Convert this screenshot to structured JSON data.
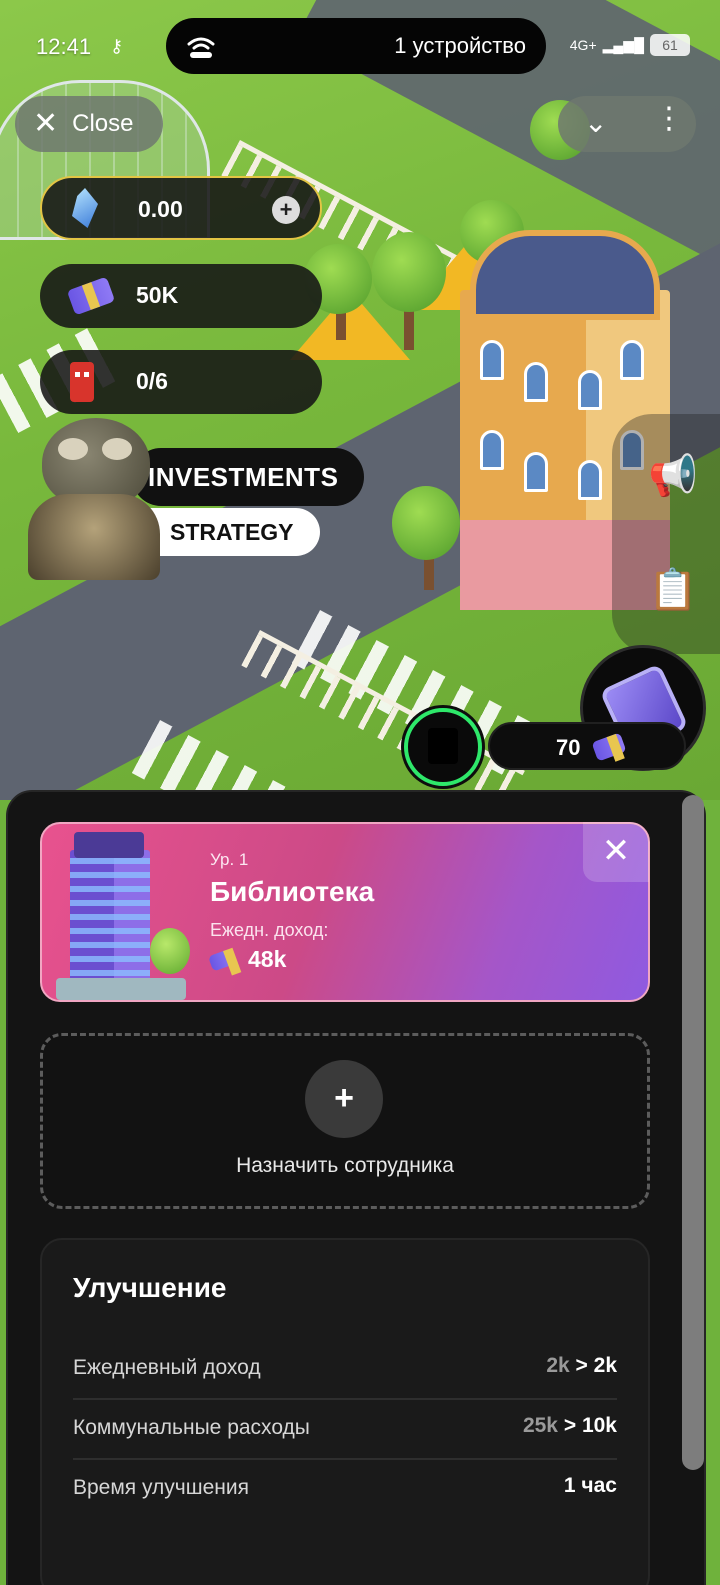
{
  "status_bar": {
    "time": "12:41",
    "key_icon": "key-icon",
    "pill_text": "1 устройство",
    "network": "4G+",
    "battery": "61"
  },
  "top_controls": {
    "close_label": "Close"
  },
  "resources": {
    "gems": "0.00",
    "cash": "50K",
    "workers": "0/6"
  },
  "badge": {
    "investments": "INVESTMENTS",
    "strategy": "STRATEGY"
  },
  "side": {
    "coin_value": "70"
  },
  "building": {
    "level": "Ур. 1",
    "name": "Библиотека",
    "income_label": "Ежедн. доход:",
    "income_value": "48k"
  },
  "assign": {
    "plus": "+",
    "label": "Назначить сотрудника"
  },
  "upgrade": {
    "title": "Улучшение",
    "rows": [
      {
        "label": "Ежедневный доход",
        "old": "2k",
        "arrow": ">",
        "new": "2k"
      },
      {
        "label": "Коммунальные расходы",
        "old": "25k",
        "arrow": ">",
        "new": "10k"
      },
      {
        "label": "Время улучшения",
        "old": "",
        "arrow": "",
        "new": "1 час"
      }
    ]
  },
  "colors": {
    "accent_pink": "#e8528e",
    "accent_purple": "#8f5ae0",
    "avatar_ring": "#2ee86a",
    "gem_border": "#e2c544"
  }
}
